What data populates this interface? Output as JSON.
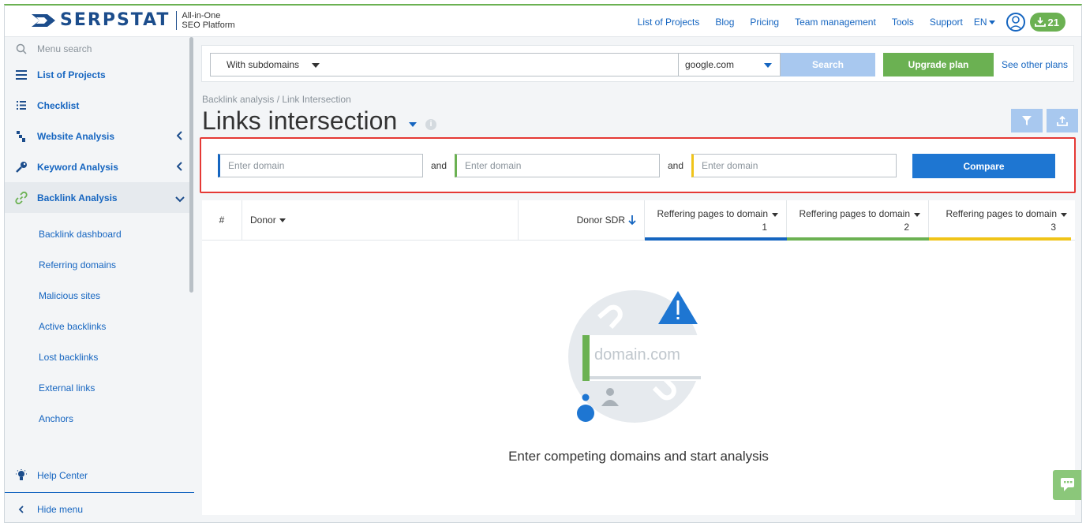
{
  "brand": {
    "name": "SERPSTAT",
    "tagline_line1": "All-in-One",
    "tagline_line2": "SEO Platform",
    "color": "#1c4d8c"
  },
  "nav": {
    "links": [
      "List of Projects",
      "Blog",
      "Pricing",
      "Team management",
      "Tools",
      "Support"
    ],
    "language": "EN",
    "download_count": "21"
  },
  "sidebar": {
    "search_placeholder": "Menu search",
    "items": [
      {
        "label": "List of Projects",
        "icon": "list-icon"
      },
      {
        "label": "Checklist",
        "icon": "checklist-icon"
      },
      {
        "label": "Website Analysis",
        "icon": "website-analysis-icon"
      },
      {
        "label": "Keyword Analysis",
        "icon": "key-icon"
      },
      {
        "label": "Backlink Analysis",
        "icon": "link-icon"
      }
    ],
    "sub_items": [
      "Backlink dashboard",
      "Referring domains",
      "Malicious sites",
      "Active backlinks",
      "Lost backlinks",
      "External links",
      "Anchors"
    ],
    "help": "Help Center",
    "hide": "Hide menu"
  },
  "search": {
    "scope": "With subdomains",
    "query": "",
    "database": "google.com",
    "search_label": "Search",
    "upgrade_label": "Upgrade plan",
    "other_plans": "See other plans"
  },
  "page": {
    "breadcrumb": "Backlink analysis / Link Intersection",
    "title": "Links intersection"
  },
  "compare": {
    "placeholder": "Enter domain",
    "and_label": "and",
    "button": "Compare",
    "colors": [
      "#1565c0",
      "#6bb152",
      "#f0c419"
    ]
  },
  "table": {
    "columns": {
      "index": "#",
      "donor": "Donor",
      "donor_sdr": "Donor SDR",
      "ref1": "Reffering pages to domain",
      "ref1_num": "1",
      "ref2": "Reffering pages to domain",
      "ref2_num": "2",
      "ref3": "Reffering pages to domain",
      "ref3_num": "3"
    },
    "empty_illustration_text": "domain.com",
    "empty_message": "Enter competing domains and start analysis"
  }
}
